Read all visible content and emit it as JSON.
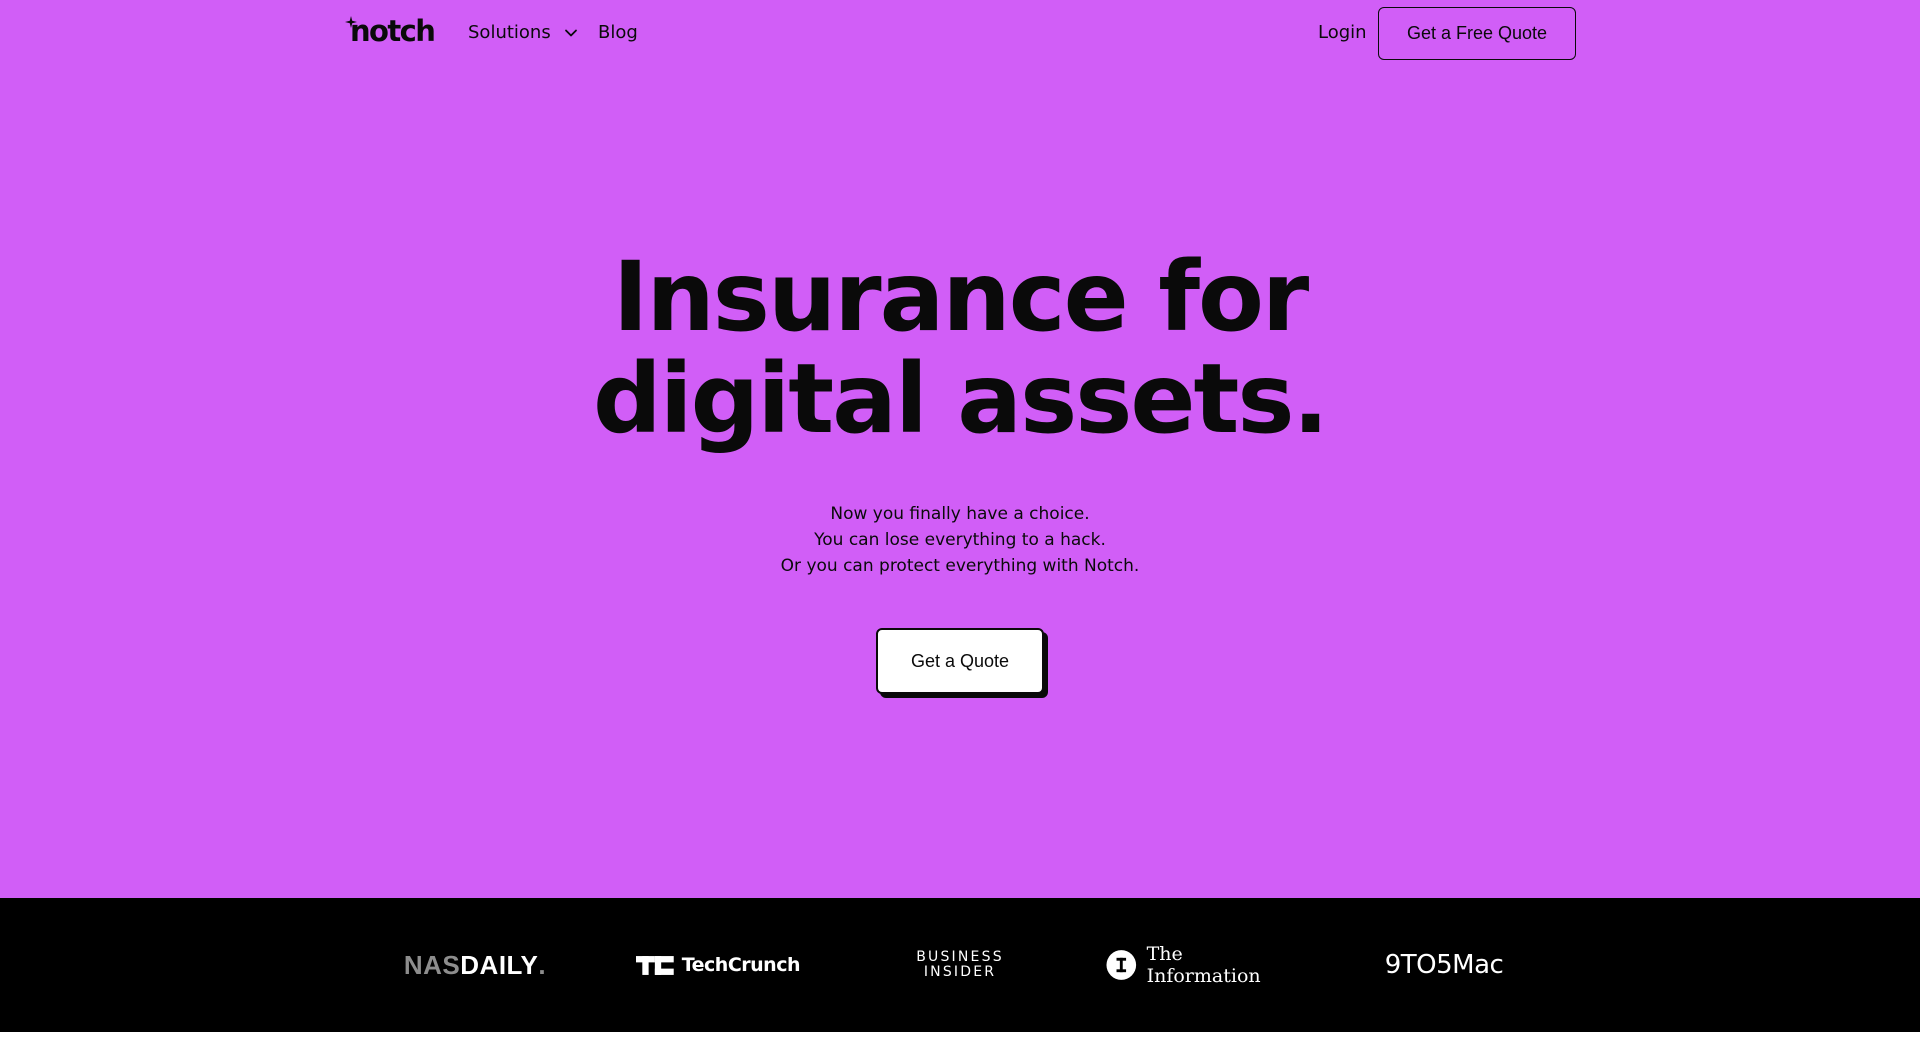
{
  "nav": {
    "logo_text": "notch",
    "solutions_label": "Solutions",
    "blog_label": "Blog",
    "login_label": "Login",
    "cta_label": "Get a Free Quote"
  },
  "hero": {
    "headline_line1": "Insurance for",
    "headline_line2": "digital assets.",
    "sub_line1": "Now you finally have a choice.",
    "sub_line2": "You can lose everything to a hack.",
    "sub_line3": "Or you can protect everything with Notch.",
    "cta_label": "Get a Quote"
  },
  "press": {
    "nasdaily_nas": "NAS",
    "nasdaily_daily": "DAILY",
    "nasdaily_dot": ".",
    "techcrunch": "TechCrunch",
    "bi_line1": "BUSINESS",
    "bi_line2": "INSIDER",
    "the_information": "The Information",
    "ninetofivemac": "9TO5Mac"
  },
  "colors": {
    "hero_bg": "#d15ef7",
    "press_bg": "#000000",
    "text": "#0a0a0a"
  }
}
